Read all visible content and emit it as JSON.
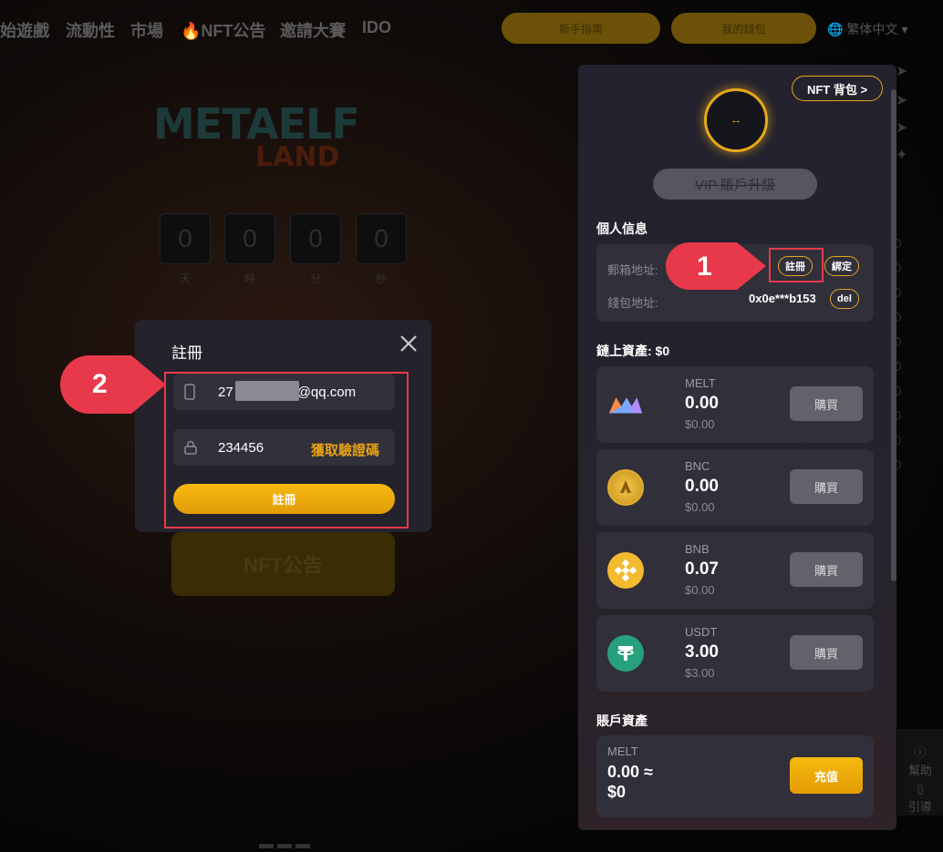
{
  "background": {
    "nav": [
      "始遊戲",
      "流動性",
      "市場",
      "🔥NFT公告",
      "邀請大賽",
      "IDO"
    ],
    "nav_buttons": [
      "新手指南",
      "我的錢包"
    ],
    "language": "繁体中文",
    "logo_line1": "METAELF",
    "logo_line2": "LAND",
    "countdown": [
      {
        "value": "0",
        "unit": "天"
      },
      {
        "value": "0",
        "unit": "時"
      },
      {
        "value": "0",
        "unit": "分"
      },
      {
        "value": "0",
        "unit": "秒"
      }
    ],
    "nft_button": "NFT公告",
    "help": [
      "幫助",
      "引導"
    ]
  },
  "panel": {
    "nft_bag": "NFT 背包 >",
    "avatar_text": "--",
    "vip_button": "VIP 賬戶升級",
    "personal_title": "個人信息",
    "email_label": "郵箱地址:",
    "register_pill": "註冊",
    "bind_pill": "綁定",
    "wallet_label": "錢包地址:",
    "wallet_address": "0x0e***b153",
    "del_pill": "del",
    "onchain_title": "鏈上資產: $0",
    "assets": [
      {
        "symbol": "MELT",
        "amount": "0.00",
        "usd": "$0.00",
        "buy": "購買",
        "icon": "melt-icon"
      },
      {
        "symbol": "BNC",
        "amount": "0.00",
        "usd": "$0.00",
        "buy": "購買",
        "icon": "bnc-icon"
      },
      {
        "symbol": "BNB",
        "amount": "0.07",
        "usd": "$0.00",
        "buy": "購買",
        "icon": "bnb-icon"
      },
      {
        "symbol": "USDT",
        "amount": "3.00",
        "usd": "$3.00",
        "buy": "購買",
        "icon": "usdt-icon"
      }
    ],
    "account_title": "賬戶資產",
    "account_asset": {
      "symbol": "MELT",
      "amount": "0.00 ≈",
      "usd": "$0",
      "button": "充值"
    }
  },
  "dialog": {
    "title": "註冊",
    "email_prefix": "27",
    "email_suffix": "@qq.com",
    "code_value": "234456",
    "get_code": "獲取驗證碼",
    "submit": "註冊"
  },
  "annotations": {
    "callout1": "1",
    "callout2": "2"
  },
  "colors": {
    "accent": "#e8a212",
    "callout": "#e8394a",
    "panel_bg": "#23222e"
  }
}
